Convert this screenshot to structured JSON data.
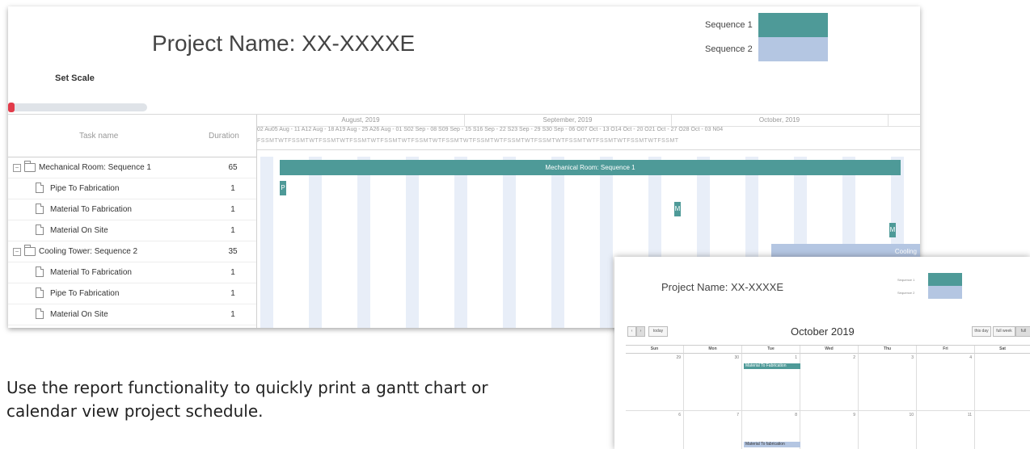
{
  "gantt": {
    "title": "Project Name: XX-XXXXE",
    "set_scale_label": "Set Scale",
    "legend": [
      {
        "label": "Sequence 1",
        "color": "#4e9a98"
      },
      {
        "label": "Sequence 2",
        "color": "#b4c6e2"
      }
    ],
    "columns": {
      "task_name": "Task name",
      "duration": "Duration"
    },
    "rows": [
      {
        "name": "Mechanical Room: Sequence 1",
        "duration": "65",
        "type": "group"
      },
      {
        "name": "Pipe To Fabrication",
        "duration": "1",
        "type": "task"
      },
      {
        "name": "Material To Fabrication",
        "duration": "1",
        "type": "task"
      },
      {
        "name": "Material On Site",
        "duration": "1",
        "type": "task"
      },
      {
        "name": "Cooling Tower: Sequence 2",
        "duration": "35",
        "type": "group"
      },
      {
        "name": "Material To Fabrication",
        "duration": "1",
        "type": "task"
      },
      {
        "name": "Pipe To Fabrication",
        "duration": "1",
        "type": "task"
      },
      {
        "name": "Material On Site",
        "duration": "1",
        "type": "task"
      }
    ],
    "months": [
      "August, 2019",
      "September, 2019",
      "October, 2019"
    ],
    "weeks_text": "02 Au05 Aug - 11 A12 Aug - 18 A19 Aug - 25 A26 Aug - 01 S02 Sep - 08 S09 Sep - 15 S16 Sep - 22 S23 Sep - 29 S30 Sep - 06 O07 Oct - 13 O14 Oct - 20 O21 Oct - 27 O28 Oct - 03 N04",
    "days_text": "FSSMTWTFSSMTWTFSSMTWTFSSMTWTFSSMTWTFSSMTWTFSSMTWTFSSMTWTFSSMTWTFSSMTWTFSSMTWTFSSMTWTFSSMTWTFSSMT",
    "bars": {
      "group1": "Mechanical Room: Sequence 1",
      "pipe": "P",
      "material_fab": "M",
      "material_site": "M",
      "group2": "Cooling"
    }
  },
  "calendar": {
    "project_title": "Project Name: XX-XXXXE",
    "legend": [
      "Sequence 1",
      "Sequence 2"
    ],
    "month_title": "October 2019",
    "nav": {
      "prev": "‹",
      "next": "›",
      "today": "today"
    },
    "views": [
      "this day",
      "full week",
      "full"
    ],
    "weekdays": [
      "Sun",
      "Mon",
      "Tue",
      "Wed",
      "Thu",
      "Fri",
      "Sat"
    ],
    "week1_days": [
      "29",
      "30",
      "1",
      "2",
      "3",
      "4",
      ""
    ],
    "week2_days": [
      "6",
      "7",
      "8",
      "9",
      "10",
      "11",
      ""
    ],
    "events": [
      {
        "title": "Material To Fabrication",
        "color": "#4e9a98"
      },
      {
        "title": "Material To fabrication",
        "color": "#b4c6e2"
      }
    ]
  },
  "caption": {
    "line1": "Use the report functionality to quickly print a gantt chart or",
    "line2": "calendar view project schedule."
  }
}
